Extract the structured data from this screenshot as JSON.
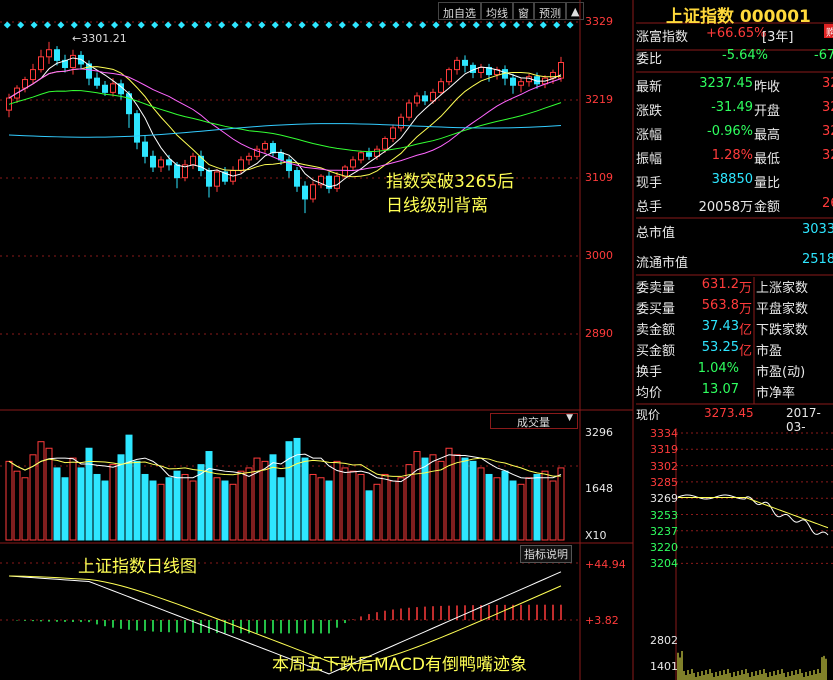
{
  "toolbar": {
    "buttons": [
      "加自选",
      "均线",
      "窗",
      "预测"
    ],
    "menu_arrow": "▲"
  },
  "chart_main": {
    "price_axis": [
      "3329",
      "3219",
      "3109",
      "3000",
      "2890"
    ],
    "high_marker": "3301.21",
    "annotation1_line1": "指数突破3265后",
    "annotation1_line2": "日线级别背离"
  },
  "volume_panel": {
    "selector": "成交量",
    "axis": [
      "3296",
      "1648"
    ],
    "unit": "X10",
    "indicator_button": "指标说明"
  },
  "macd_panel": {
    "title_annotation": "上证指数日线图",
    "bottom_annotation": "本周五下跌后MACD有倒鸭嘴迹象",
    "axis_top": "+44.94",
    "axis_bottom": "+3.82"
  },
  "quote": {
    "title": "上证指数 000001",
    "badge": "购",
    "rows1": [
      {
        "l": "涨富指数",
        "v": "+66.65%",
        "extra": "[3年]"
      },
      {
        "l": "委比",
        "v": "-5.64%",
        "r": "-67"
      }
    ],
    "rows2": [
      {
        "l": "最新",
        "v": "3237.45",
        "r": "昨收",
        "rv": "32"
      },
      {
        "l": "涨跌",
        "v": "-31.49",
        "r": "开盘",
        "rv": "32"
      },
      {
        "l": "涨幅",
        "v": "-0.96%",
        "r": "最高",
        "rv": "32"
      },
      {
        "l": "振幅",
        "v": "1.28%",
        "r": "最低",
        "rv": "32"
      },
      {
        "l": "现手",
        "v": "38850",
        "r": "量比",
        "rv": ""
      },
      {
        "l": "总手",
        "v": "20058万",
        "r": "金额",
        "rv": "26"
      }
    ],
    "cap": [
      {
        "l": "总市值",
        "v": "3033"
      },
      {
        "l": "流通市值",
        "v": "2518"
      }
    ],
    "rows3": [
      {
        "l": "委卖量",
        "v": "631.2",
        "u": "万",
        "r": "上涨家数"
      },
      {
        "l": "委买量",
        "v": "563.8",
        "u": "万",
        "r": "平盘家数"
      },
      {
        "l": "卖金额",
        "v": "37.43",
        "u": "亿",
        "r": "下跌家数"
      },
      {
        "l": "买金额",
        "v": "53.25",
        "u": "亿",
        "r": "市盈"
      },
      {
        "l": "换手",
        "v": "1.04%",
        "u": "",
        "r": "市盈(动)"
      },
      {
        "l": "均价",
        "v": "13.07",
        "u": "",
        "r": "市净率"
      }
    ],
    "now_label": "现价",
    "now_value": "3273.45",
    "date": "2017-03-",
    "intraday_axis": [
      "3334",
      "3319",
      "3302",
      "3285",
      "3269",
      "3253",
      "3237",
      "3220",
      "3204"
    ],
    "intraday_vol_axis": [
      "2802",
      "1401"
    ]
  },
  "colors": {
    "up": "#ff3b3b",
    "down": "#2ee6ff",
    "grid": "#8a1a1a"
  }
}
